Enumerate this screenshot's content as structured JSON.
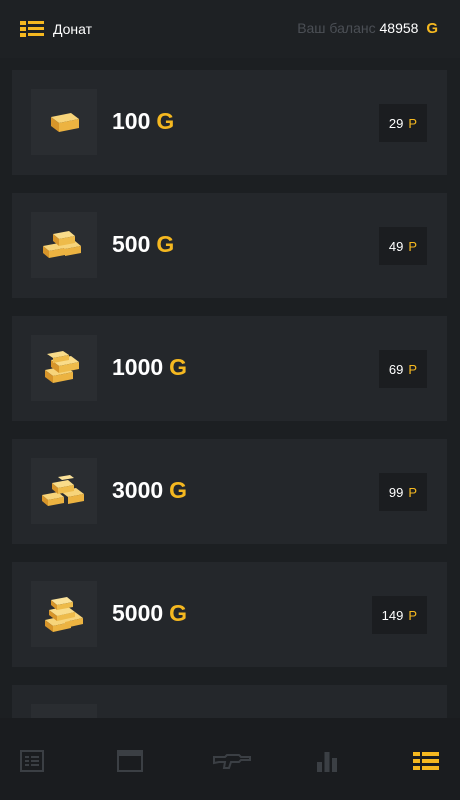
{
  "header": {
    "title": "Донат",
    "balance_label": "Ваш баланс",
    "balance_value": "48958",
    "currency_symbol": "G"
  },
  "items": [
    {
      "amount": "100",
      "currency": "G",
      "price": "29",
      "price_currency": "Р"
    },
    {
      "amount": "500",
      "currency": "G",
      "price": "49",
      "price_currency": "Р"
    },
    {
      "amount": "1000",
      "currency": "G",
      "price": "69",
      "price_currency": "Р"
    },
    {
      "amount": "3000",
      "currency": "G",
      "price": "99",
      "price_currency": "Р"
    },
    {
      "amount": "5000",
      "currency": "G",
      "price": "149",
      "price_currency": "Р"
    }
  ],
  "icons": {
    "menu": "gold-stack-icon",
    "item_thumbs": [
      "gold-bar-icon",
      "gold-bars-icon",
      "gold-bars-icon",
      "gold-bars-icon",
      "gold-pile-icon",
      "gold-bar-icon"
    ],
    "nav": [
      "list-icon",
      "window-icon",
      "rifle-icon",
      "bar-chart-icon",
      "gold-stack-icon"
    ]
  },
  "colors": {
    "accent": "#f5b820",
    "background": "#1c1f22",
    "card": "#24272b",
    "nav_inactive": "#3b3f44"
  }
}
